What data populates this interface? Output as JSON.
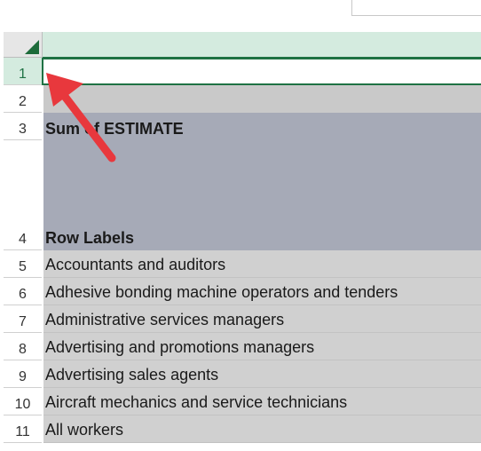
{
  "sheet": {
    "selected_row": "1",
    "rows": [
      {
        "num": "1",
        "text": ""
      },
      {
        "num": "2",
        "text": ""
      },
      {
        "num": "3",
        "text": "Sum of ESTIMATE"
      },
      {
        "num": "4",
        "text": "Row Labels"
      },
      {
        "num": "5",
        "text": "Accountants and auditors"
      },
      {
        "num": "6",
        "text": "Adhesive bonding machine operators and tenders"
      },
      {
        "num": "7",
        "text": "Administrative services managers"
      },
      {
        "num": "8",
        "text": "Advertising and promotions managers"
      },
      {
        "num": "9",
        "text": "Advertising sales agents"
      },
      {
        "num": "10",
        "text": "Aircraft mechanics and service technicians"
      },
      {
        "num": "11",
        "text": "All workers"
      }
    ]
  },
  "colors": {
    "accent": "#1f7244",
    "annotation_arrow": "#e8383d",
    "pivot_header": "#a6aab7"
  },
  "icons": {
    "select_all": "select-all-triangle-icon",
    "annotation": "red-arrow-icon"
  }
}
